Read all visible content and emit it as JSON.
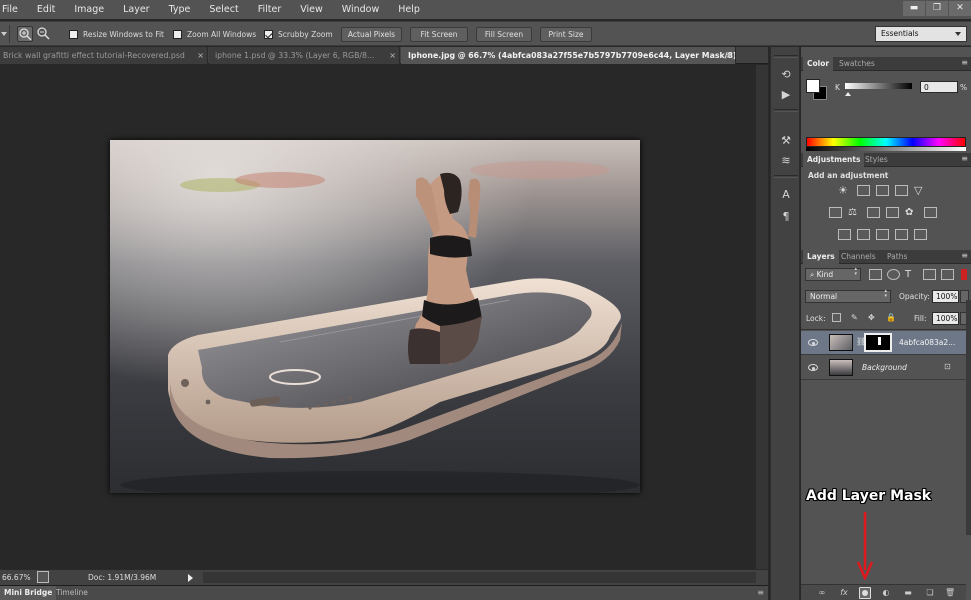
{
  "menu": [
    "File",
    "Edit",
    "Image",
    "Layer",
    "Type",
    "Select",
    "Filter",
    "View",
    "Window",
    "Help"
  ],
  "window_controls": {
    "minimize": "▬",
    "restore": "❐",
    "close": "✕"
  },
  "options": {
    "resize_windows": "Resize Windows to Fit",
    "zoom_all": "Zoom All Windows",
    "scrubby_zoom": "Scrubby Zoom",
    "actual_pixels": "Actual Pixels",
    "fit_screen": "Fit Screen",
    "fill_screen": "Fill Screen",
    "print_size": "Print Size",
    "workspace": "Essentials",
    "resize_checked": false,
    "zoom_all_checked": false,
    "scrubby_checked": true
  },
  "tabs": [
    {
      "label": "Brick wall grafitti effect tutorial-Recovered.psd",
      "close": "×"
    },
    {
      "label": "iphone 1.psd @ 33.3% (Layer 6, RGB/8...",
      "close": "×"
    },
    {
      "label": "Iphone.jpg @ 66.7% (4abfca083a27f55e7b5797b7709e6c44, Layer Mask/8) *",
      "close": "×"
    }
  ],
  "status": {
    "zoom": "66.67%",
    "doc": "Doc: 1.91M/3.96M"
  },
  "bottom_tabs": [
    "Mini Bridge",
    "Timeline"
  ],
  "color_panel": {
    "tabs": [
      "Color",
      "Swatches"
    ],
    "channel": "K",
    "value": "0",
    "unit": "%"
  },
  "adjustments_panel": {
    "tabs": [
      "Adjustments",
      "Styles"
    ],
    "heading": "Add an adjustment"
  },
  "layers_panel": {
    "tabs": [
      "Layers",
      "Channels",
      "Paths"
    ],
    "filter": "Kind",
    "blend_mode": "Normal",
    "opacity_label": "Opacity:",
    "opacity": "100%",
    "lock_label": "Lock:",
    "fill_label": "Fill:",
    "fill": "100%",
    "layers": [
      {
        "name": "4abfca083a2..."
      },
      {
        "name": "Background"
      }
    ]
  },
  "callout": "Add Layer Mask",
  "accent": "#e0191f"
}
